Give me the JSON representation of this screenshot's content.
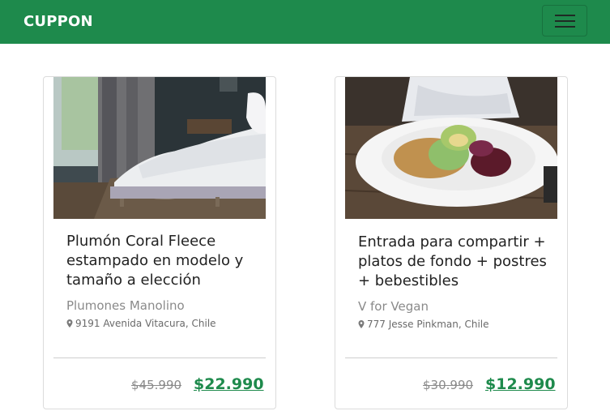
{
  "navbar": {
    "brand": "CUPPON",
    "accent_color": "#1e8a4c",
    "menu_icon": "hamburger-menu-icon"
  },
  "cards": [
    {
      "title": "Plumón Coral Fleece estampado en modelo y tamaño a elección",
      "merchant": "Plumones Manolino",
      "address": "9191 Avenida Vitacura, Chile",
      "old_price": "$45.990",
      "new_price": "$22.990",
      "image": "bedroom-bed-image"
    },
    {
      "title": "Entrada para compartir + platos de fondo + postres + bebestibles",
      "merchant": "V for Vegan",
      "address": "777 Jesse Pinkman, Chile",
      "old_price": "$30.990",
      "new_price": "$12.990",
      "image": "vegan-salad-bowl-image"
    }
  ]
}
